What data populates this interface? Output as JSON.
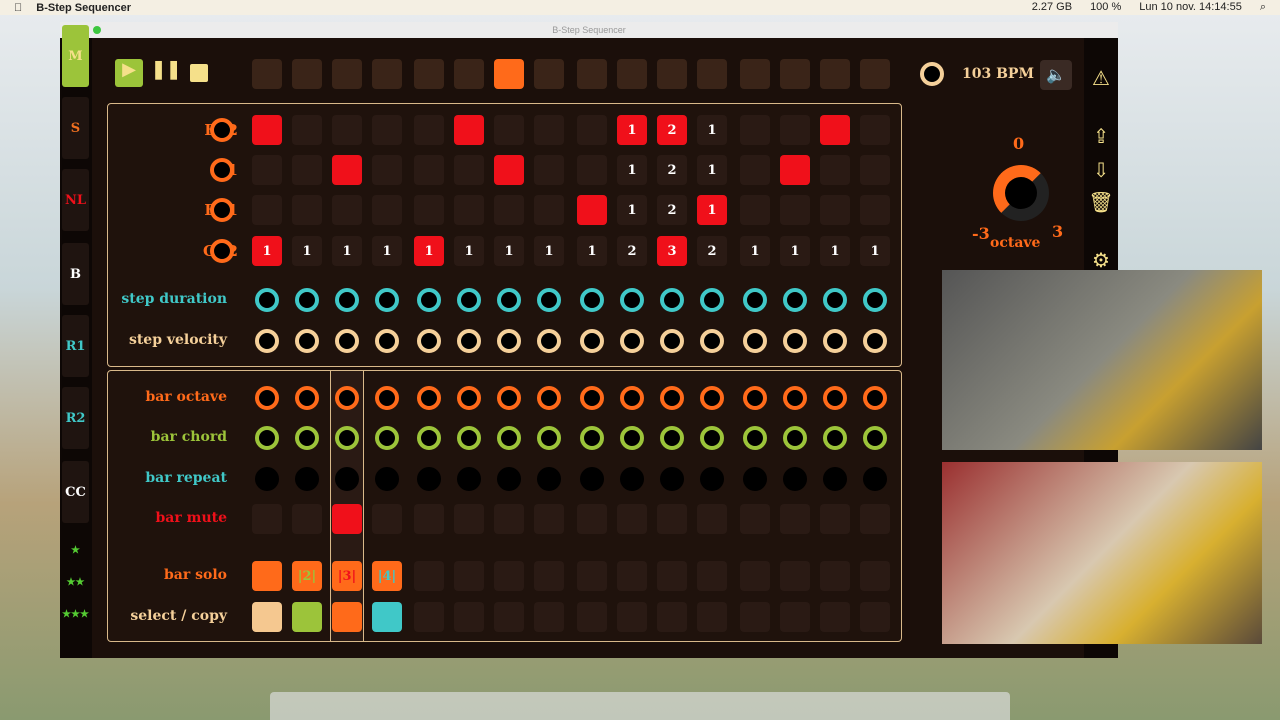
{
  "menubar": {
    "app": "B-Step Sequencer",
    "memory": "2.27 GB",
    "battery": "100 %",
    "datetime": "Lun 10 nov.  14:14:55"
  },
  "window": {
    "title": "B-Step Sequencer"
  },
  "sidebar": [
    "M",
    "S",
    "NL",
    "B",
    "R1",
    "R2",
    "CC",
    "★",
    "★★",
    "★★★"
  ],
  "transport": {
    "bpm": "103 BPM",
    "current_step": 6
  },
  "tracks": [
    {
      "name": "F#2",
      "cells": [
        "r",
        "",
        "",
        "",
        "",
        "r",
        "",
        "",
        "",
        "1r",
        "2r",
        "1",
        "",
        "",
        "r",
        ""
      ]
    },
    {
      "name": "A1",
      "cells": [
        "",
        "",
        "r",
        "",
        "",
        "",
        "r",
        "",
        "",
        "1",
        "2",
        "1",
        "",
        "r",
        "",
        ""
      ]
    },
    {
      "name": "F#1",
      "cells": [
        "",
        "",
        "",
        "",
        "",
        "",
        "",
        "",
        "r",
        "1",
        "2",
        "1r",
        "",
        "",
        "",
        ""
      ]
    },
    {
      "name": "C#2",
      "cells": [
        "1r",
        "1",
        "1",
        "1",
        "1r",
        "1",
        "1",
        "1",
        "1",
        "2",
        "3r",
        "2",
        "1",
        "1",
        "1",
        "1"
      ]
    }
  ],
  "step_rows": [
    "step duration",
    "step velocity"
  ],
  "bar_rows": [
    "bar octave",
    "bar chord",
    "bar repeat",
    "bar mute",
    "bar solo",
    "select / copy"
  ],
  "bar_solo": [
    "",
    "|2|",
    "|3|",
    "|4|"
  ],
  "selected_bar": 2,
  "octave": {
    "label": "octave",
    "min": "-3",
    "center": "0",
    "max": "3"
  },
  "colors": {
    "accent": "#ff6a1a",
    "red": "#f0101a",
    "cyan": "#40c8c8",
    "green": "#9cc43a",
    "cream": "#f5e08a"
  }
}
